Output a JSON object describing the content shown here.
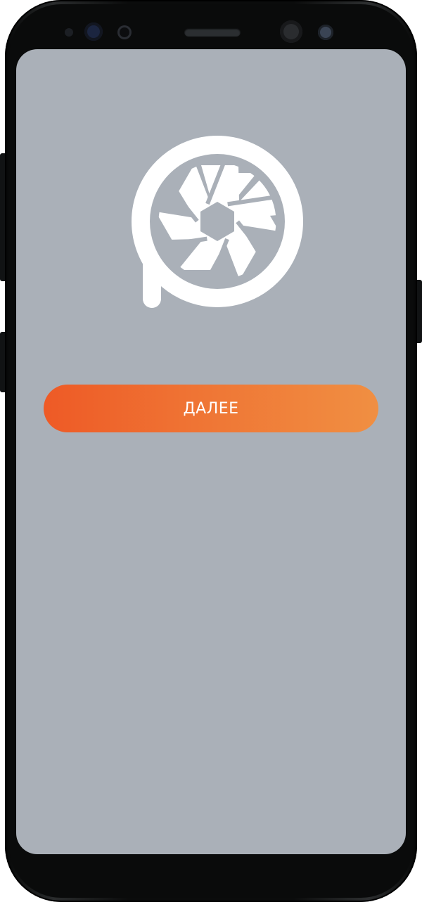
{
  "device": {
    "frame_color": "#0b0c0c",
    "screen_background": "#aab0b8"
  },
  "logo": {
    "icon": "camera-aperture-logo-icon",
    "color": "#ffffff"
  },
  "next_button": {
    "label": "ДАЛЕЕ",
    "gradient_start": "#ee5a26",
    "gradient_end": "#f08f42"
  }
}
